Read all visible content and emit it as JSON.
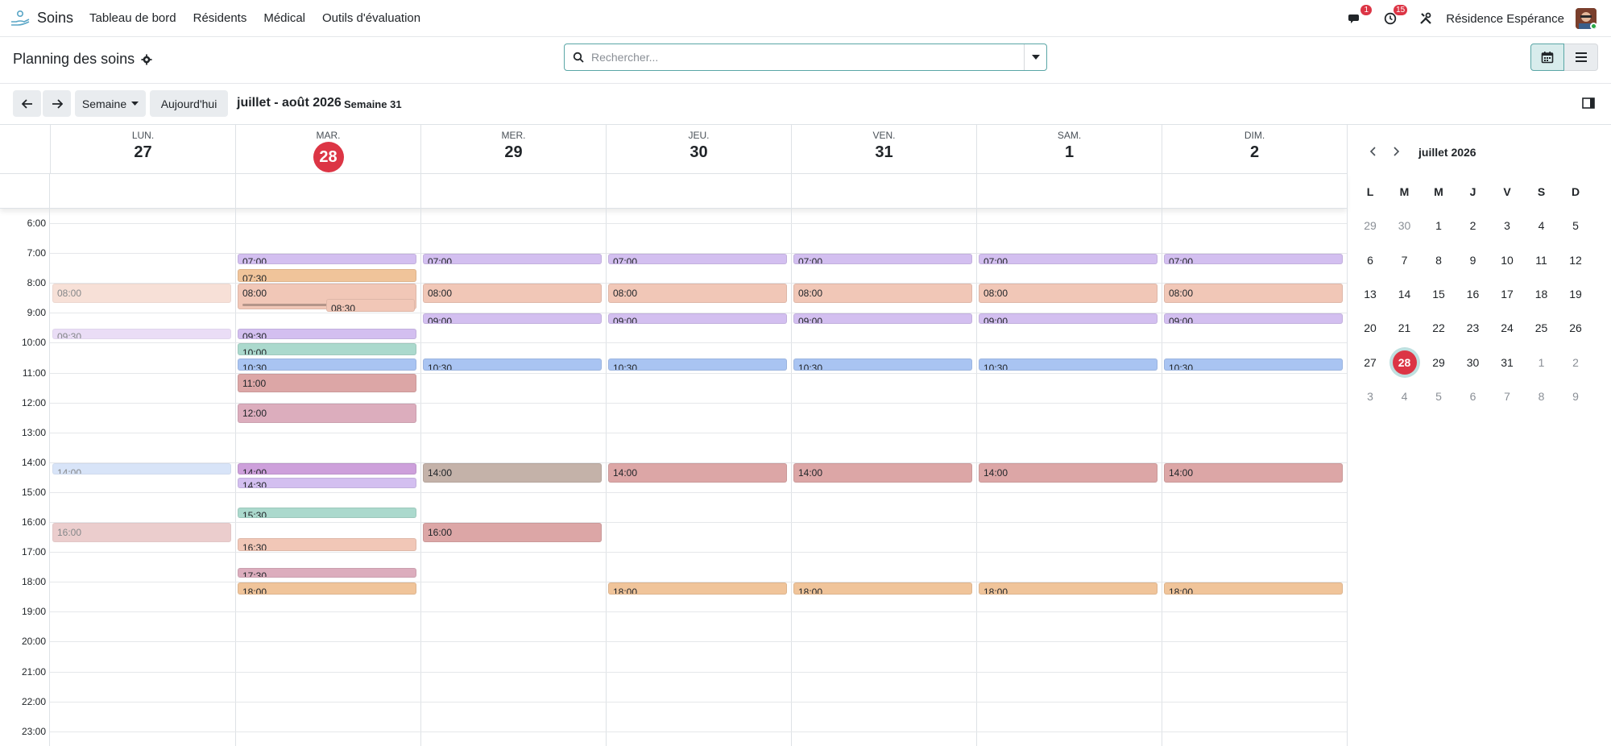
{
  "navbar": {
    "app_name": "Soins",
    "menu": [
      "Tableau de bord",
      "Résidents",
      "Médical",
      "Outils d'évaluation"
    ],
    "messages_count": "1",
    "activities_count": "15",
    "company": "Résidence Espérance"
  },
  "control_panel": {
    "title": "Planning des soins",
    "search_placeholder": "Rechercher..."
  },
  "toolbar": {
    "scale_label": "Semaine",
    "today_label": "Aujourd'hui",
    "range": "juillet - août 2026",
    "week": "Semaine 31"
  },
  "calendar": {
    "days": [
      {
        "dow": "LUN.",
        "num": "27"
      },
      {
        "dow": "MAR.",
        "num": "28",
        "today": true
      },
      {
        "dow": "MER.",
        "num": "29"
      },
      {
        "dow": "JEU.",
        "num": "30"
      },
      {
        "dow": "VEN.",
        "num": "31"
      },
      {
        "dow": "SAM.",
        "num": "1"
      },
      {
        "dow": "DIM.",
        "num": "2"
      }
    ],
    "hours": [
      "6:00",
      "7:00",
      "8:00",
      "9:00",
      "10:00",
      "11:00",
      "12:00",
      "13:00",
      "14:00",
      "15:00",
      "16:00",
      "17:00",
      "18:00",
      "19:00",
      "20:00",
      "21:00",
      "22:00",
      "23:00"
    ],
    "events": [
      {
        "day": 0,
        "time": "08:00",
        "start": 8.0,
        "dur": 0.7,
        "color": "#f1c7b7",
        "faded": true,
        "lines": true
      },
      {
        "day": 0,
        "time": "09:30",
        "start": 9.5,
        "dur": 0.4,
        "color": "#d9c3f0",
        "faded": true
      },
      {
        "day": 0,
        "time": "14:00",
        "start": 14.0,
        "dur": 0.45,
        "color": "#b9cff3",
        "faded": true
      },
      {
        "day": 0,
        "time": "16:00",
        "start": 16.0,
        "dur": 0.7,
        "color": "#dca6a6",
        "faded": true,
        "lines": true
      },
      {
        "day": 1,
        "time": "07:00",
        "start": 7.0,
        "dur": 0.4,
        "color": "#d3bff0"
      },
      {
        "day": 1,
        "time": "07:30",
        "start": 7.5,
        "dur": 0.5,
        "color": "#f0c49a"
      },
      {
        "day": 1,
        "time": "08:00",
        "start": 8.0,
        "dur": 0.9,
        "color": "#f1c7b7",
        "lines": true
      },
      {
        "day": 1,
        "time": "08:30",
        "start": 8.5,
        "dur": 0.5,
        "color": "#f1c7b7",
        "sub": true
      },
      {
        "day": 1,
        "time": "09:30",
        "start": 9.5,
        "dur": 0.4,
        "color": "#d3bff0"
      },
      {
        "day": 1,
        "time": "10:00",
        "start": 10.0,
        "dur": 0.45,
        "color": "#abd9cd"
      },
      {
        "day": 1,
        "time": "10:30",
        "start": 10.5,
        "dur": 0.45,
        "color": "#a9c4f2"
      },
      {
        "day": 1,
        "time": "11:00",
        "start": 11.0,
        "dur": 0.7,
        "color": "#dca6a6",
        "lines": true
      },
      {
        "day": 1,
        "time": "12:00",
        "start": 12.0,
        "dur": 0.7,
        "color": "#dcadbd",
        "lines": true
      },
      {
        "day": 1,
        "time": "14:00",
        "start": 14.0,
        "dur": 0.45,
        "color": "#cda0db"
      },
      {
        "day": 1,
        "time": "14:30",
        "start": 14.5,
        "dur": 0.4,
        "color": "#d3bff0"
      },
      {
        "day": 1,
        "time": "15:30",
        "start": 15.5,
        "dur": 0.4,
        "color": "#abd9cd"
      },
      {
        "day": 1,
        "time": "16:30",
        "start": 16.5,
        "dur": 0.5,
        "color": "#f1c7b7"
      },
      {
        "day": 1,
        "time": "17:30",
        "start": 17.5,
        "dur": 0.4,
        "color": "#dcadbd"
      },
      {
        "day": 1,
        "time": "18:00",
        "start": 18.0,
        "dur": 0.45,
        "color": "#f0c49a"
      },
      {
        "day": 2,
        "time": "07:00",
        "start": 7.0,
        "dur": 0.4,
        "color": "#d3bff0"
      },
      {
        "day": 2,
        "time": "08:00",
        "start": 8.0,
        "dur": 0.7,
        "color": "#f1c7b7",
        "lines": true
      },
      {
        "day": 2,
        "time": "09:00",
        "start": 9.0,
        "dur": 0.4,
        "color": "#d3bff0"
      },
      {
        "day": 2,
        "time": "10:30",
        "start": 10.5,
        "dur": 0.45,
        "color": "#a9c4f2"
      },
      {
        "day": 2,
        "time": "14:00",
        "start": 14.0,
        "dur": 0.7,
        "color": "#c4b2a9",
        "lines": true
      },
      {
        "day": 2,
        "time": "16:00",
        "start": 16.0,
        "dur": 0.7,
        "color": "#dca6a6",
        "lines": true
      },
      {
        "day": 3,
        "time": "07:00",
        "start": 7.0,
        "dur": 0.4,
        "color": "#d3bff0"
      },
      {
        "day": 3,
        "time": "08:00",
        "start": 8.0,
        "dur": 0.7,
        "color": "#f1c7b7",
        "lines": true
      },
      {
        "day": 3,
        "time": "09:00",
        "start": 9.0,
        "dur": 0.4,
        "color": "#d3bff0"
      },
      {
        "day": 3,
        "time": "10:30",
        "start": 10.5,
        "dur": 0.45,
        "color": "#a9c4f2"
      },
      {
        "day": 3,
        "time": "14:00",
        "start": 14.0,
        "dur": 0.7,
        "color": "#dca6a6",
        "lines": true
      },
      {
        "day": 3,
        "time": "18:00",
        "start": 18.0,
        "dur": 0.45,
        "color": "#f0c49a"
      },
      {
        "day": 4,
        "time": "07:00",
        "start": 7.0,
        "dur": 0.4,
        "color": "#d3bff0"
      },
      {
        "day": 4,
        "time": "08:00",
        "start": 8.0,
        "dur": 0.7,
        "color": "#f1c7b7",
        "lines": true
      },
      {
        "day": 4,
        "time": "09:00",
        "start": 9.0,
        "dur": 0.4,
        "color": "#d3bff0"
      },
      {
        "day": 4,
        "time": "10:30",
        "start": 10.5,
        "dur": 0.45,
        "color": "#a9c4f2"
      },
      {
        "day": 4,
        "time": "14:00",
        "start": 14.0,
        "dur": 0.7,
        "color": "#dca6a6",
        "lines": true
      },
      {
        "day": 4,
        "time": "18:00",
        "start": 18.0,
        "dur": 0.45,
        "color": "#f0c49a"
      },
      {
        "day": 5,
        "time": "07:00",
        "start": 7.0,
        "dur": 0.4,
        "color": "#d3bff0"
      },
      {
        "day": 5,
        "time": "08:00",
        "start": 8.0,
        "dur": 0.7,
        "color": "#f1c7b7",
        "lines": true
      },
      {
        "day": 5,
        "time": "09:00",
        "start": 9.0,
        "dur": 0.4,
        "color": "#d3bff0"
      },
      {
        "day": 5,
        "time": "10:30",
        "start": 10.5,
        "dur": 0.45,
        "color": "#a9c4f2"
      },
      {
        "day": 5,
        "time": "14:00",
        "start": 14.0,
        "dur": 0.7,
        "color": "#dca6a6",
        "lines": true
      },
      {
        "day": 5,
        "time": "18:00",
        "start": 18.0,
        "dur": 0.45,
        "color": "#f0c49a"
      },
      {
        "day": 6,
        "time": "07:00",
        "start": 7.0,
        "dur": 0.4,
        "color": "#d3bff0"
      },
      {
        "day": 6,
        "time": "08:00",
        "start": 8.0,
        "dur": 0.7,
        "color": "#f1c7b7",
        "lines": true
      },
      {
        "day": 6,
        "time": "09:00",
        "start": 9.0,
        "dur": 0.4,
        "color": "#d3bff0"
      },
      {
        "day": 6,
        "time": "10:30",
        "start": 10.5,
        "dur": 0.45,
        "color": "#a9c4f2"
      },
      {
        "day": 6,
        "time": "14:00",
        "start": 14.0,
        "dur": 0.7,
        "color": "#dca6a6",
        "lines": true
      },
      {
        "day": 6,
        "time": "18:00",
        "start": 18.0,
        "dur": 0.45,
        "color": "#f0c49a"
      }
    ]
  },
  "mini_calendar": {
    "month": "juillet 2026",
    "dow": [
      "L",
      "M",
      "M",
      "J",
      "V",
      "S",
      "D"
    ],
    "weeks": [
      [
        {
          "d": "29",
          "o": true
        },
        {
          "d": "30",
          "o": true
        },
        {
          "d": "1"
        },
        {
          "d": "2"
        },
        {
          "d": "3"
        },
        {
          "d": "4"
        },
        {
          "d": "5"
        }
      ],
      [
        {
          "d": "6"
        },
        {
          "d": "7"
        },
        {
          "d": "8"
        },
        {
          "d": "9"
        },
        {
          "d": "10"
        },
        {
          "d": "11"
        },
        {
          "d": "12"
        }
      ],
      [
        {
          "d": "13"
        },
        {
          "d": "14"
        },
        {
          "d": "15"
        },
        {
          "d": "16"
        },
        {
          "d": "17"
        },
        {
          "d": "18"
        },
        {
          "d": "19"
        }
      ],
      [
        {
          "d": "20"
        },
        {
          "d": "21"
        },
        {
          "d": "22"
        },
        {
          "d": "23"
        },
        {
          "d": "24"
        },
        {
          "d": "25"
        },
        {
          "d": "26"
        }
      ],
      [
        {
          "d": "27"
        },
        {
          "d": "28",
          "t": true
        },
        {
          "d": "29"
        },
        {
          "d": "30"
        },
        {
          "d": "31"
        },
        {
          "d": "1",
          "o": true
        },
        {
          "d": "2",
          "o": true
        }
      ],
      [
        {
          "d": "3",
          "o": true
        },
        {
          "d": "4",
          "o": true
        },
        {
          "d": "5",
          "o": true
        },
        {
          "d": "6",
          "o": true
        },
        {
          "d": "7",
          "o": true
        },
        {
          "d": "8",
          "o": true
        },
        {
          "d": "9",
          "o": true
        }
      ]
    ]
  }
}
